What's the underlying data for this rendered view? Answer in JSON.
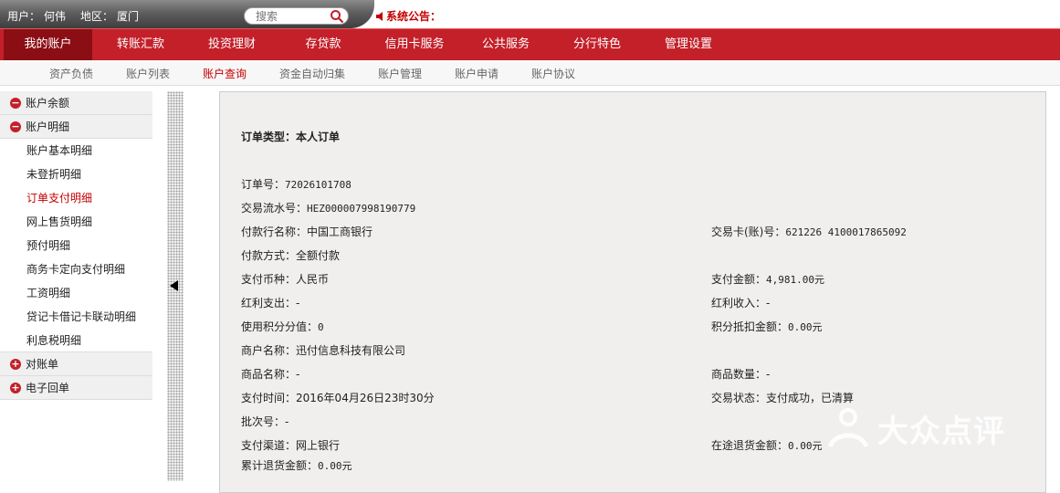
{
  "topbar": {
    "user_label": "用户：",
    "user_name": "何伟",
    "region_label": "地区：",
    "region_name": "厦门",
    "search_placeholder": "搜索",
    "announcement": "系统公告："
  },
  "main_nav": [
    {
      "label": "我的账户",
      "active": true
    },
    {
      "label": "转账汇款"
    },
    {
      "label": "投资理财"
    },
    {
      "label": "存贷款"
    },
    {
      "label": "信用卡服务"
    },
    {
      "label": "公共服务"
    },
    {
      "label": "分行特色"
    },
    {
      "label": "管理设置"
    }
  ],
  "sub_nav": [
    {
      "label": "资产负债"
    },
    {
      "label": "账户列表"
    },
    {
      "label": "账户查询",
      "active": true
    },
    {
      "label": "资金自动归集"
    },
    {
      "label": "账户管理"
    },
    {
      "label": "账户申请"
    },
    {
      "label": "账户协议"
    }
  ],
  "sidebar": {
    "balance": "账户余额",
    "details": "账户明细",
    "detail_items": [
      "账户基本明细",
      "未登折明细",
      "订单支付明细",
      "网上售货明细",
      "预付明细",
      "商务卡定向支付明细",
      "工资明细",
      "贷记卡借记卡联动明细",
      "利息税明细"
    ],
    "statement": "对账单",
    "e_receipt": "电子回单"
  },
  "order": {
    "title": "订单类型：本人订单",
    "order_no_label": "订单号：",
    "order_no": "72026101708",
    "serial_label": "交易流水号：",
    "serial": "HEZ000007998190779",
    "payer_bank_label": "付款行名称：",
    "payer_bank": "中国工商银行",
    "card_label": "交易卡(账)号：",
    "card": "621226 4100017865092",
    "pay_method_label": "付款方式：",
    "pay_method": "全额付款",
    "currency_label": "支付币种：",
    "currency": "人民币",
    "amount_label": "支付金额：",
    "amount": "4,981.00元",
    "bonus_out_label": "红利支出：",
    "bonus_out": "-",
    "bonus_in_label": "红利收入：",
    "bonus_in": "-",
    "points_used_label": "使用积分分值：",
    "points_used": "0",
    "points_deduct_label": "积分抵扣金额：",
    "points_deduct": "0.00元",
    "merchant_label": "商户名称：",
    "merchant": "迅付信息科技有限公司",
    "product_label": "商品名称：",
    "product": "-",
    "qty_label": "商品数量：",
    "qty": "-",
    "pay_time_label": "支付时间：",
    "pay_time": "2016年04月26日23时30分",
    "status_label": "交易状态：",
    "status": "支付成功，已清算",
    "batch_label": "批次号：",
    "batch": "-",
    "channel_label": "支付渠道：",
    "channel": "网上银行",
    "refund_transit_label": "在途退货金额：",
    "refund_transit": "0.00元",
    "refund_total_label": "累计退货金额：",
    "refund_total": "0.00元"
  },
  "watermark": "大众点评",
  "colors": {
    "brand_red": "#c3202a",
    "active_red": "#8c0e15",
    "link_red": "#c40000"
  }
}
